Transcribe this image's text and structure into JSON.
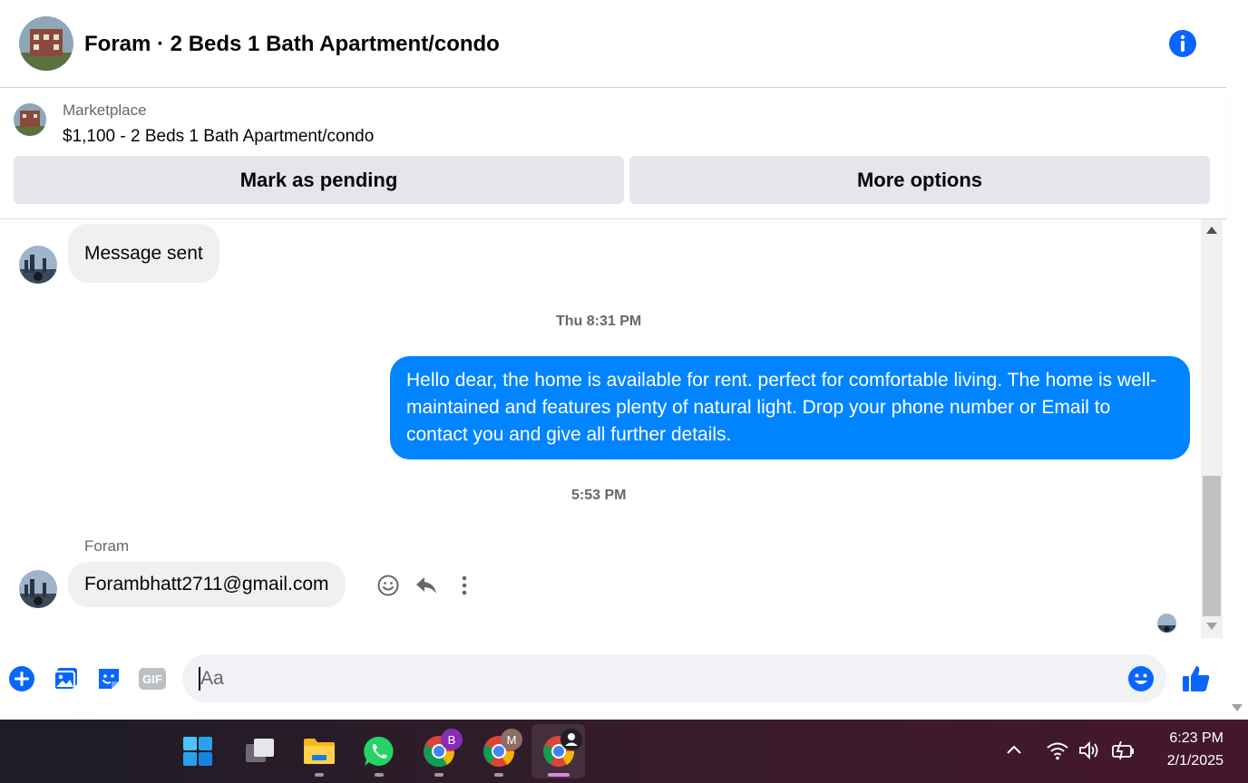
{
  "header": {
    "title": "Foram · 2 Beds 1 Bath Apartment/condo",
    "info_icon": "info-icon"
  },
  "listing": {
    "label": "Marketplace",
    "price_title": "$1,100 - 2 Beds 1 Bath Apartment/condo",
    "buttons": {
      "pending": "Mark as pending",
      "more": "More options"
    }
  },
  "messages": {
    "first_in": "Message sent",
    "time1": "Thu 8:31 PM",
    "outgoing": "Hello dear,  the home is available for rent. perfect for comfortable living. The home is well-maintained and features plenty of natural light. Drop your phone number or Email to contact you and give all further details.",
    "time2": "5:53 PM",
    "sender_name": "Foram",
    "last_in": "Forambhatt2711@gmail.com"
  },
  "composer": {
    "placeholder": "Aa"
  },
  "taskbar": {
    "badge_b": "B",
    "badge_m": "M",
    "clock_time": "6:23 PM",
    "clock_date": "2/1/2025"
  },
  "colors": {
    "accent": "#0084ff",
    "fb_blue": "#0866ff",
    "bubble_gray": "#f0f0f0",
    "button_gray": "#e4e6eb"
  }
}
